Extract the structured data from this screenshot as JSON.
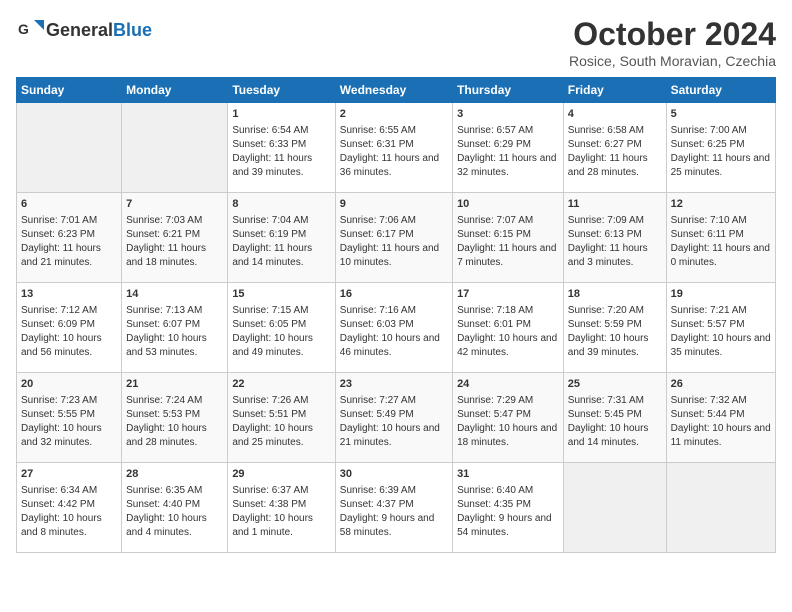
{
  "header": {
    "logo_general": "General",
    "logo_blue": "Blue",
    "month_title": "October 2024",
    "location": "Rosice, South Moravian, Czechia"
  },
  "days_of_week": [
    "Sunday",
    "Monday",
    "Tuesday",
    "Wednesday",
    "Thursday",
    "Friday",
    "Saturday"
  ],
  "weeks": [
    [
      {
        "day": "",
        "info": ""
      },
      {
        "day": "",
        "info": ""
      },
      {
        "day": "1",
        "info": "Sunrise: 6:54 AM\nSunset: 6:33 PM\nDaylight: 11 hours and 39 minutes."
      },
      {
        "day": "2",
        "info": "Sunrise: 6:55 AM\nSunset: 6:31 PM\nDaylight: 11 hours and 36 minutes."
      },
      {
        "day": "3",
        "info": "Sunrise: 6:57 AM\nSunset: 6:29 PM\nDaylight: 11 hours and 32 minutes."
      },
      {
        "day": "4",
        "info": "Sunrise: 6:58 AM\nSunset: 6:27 PM\nDaylight: 11 hours and 28 minutes."
      },
      {
        "day": "5",
        "info": "Sunrise: 7:00 AM\nSunset: 6:25 PM\nDaylight: 11 hours and 25 minutes."
      }
    ],
    [
      {
        "day": "6",
        "info": "Sunrise: 7:01 AM\nSunset: 6:23 PM\nDaylight: 11 hours and 21 minutes."
      },
      {
        "day": "7",
        "info": "Sunrise: 7:03 AM\nSunset: 6:21 PM\nDaylight: 11 hours and 18 minutes."
      },
      {
        "day": "8",
        "info": "Sunrise: 7:04 AM\nSunset: 6:19 PM\nDaylight: 11 hours and 14 minutes."
      },
      {
        "day": "9",
        "info": "Sunrise: 7:06 AM\nSunset: 6:17 PM\nDaylight: 11 hours and 10 minutes."
      },
      {
        "day": "10",
        "info": "Sunrise: 7:07 AM\nSunset: 6:15 PM\nDaylight: 11 hours and 7 minutes."
      },
      {
        "day": "11",
        "info": "Sunrise: 7:09 AM\nSunset: 6:13 PM\nDaylight: 11 hours and 3 minutes."
      },
      {
        "day": "12",
        "info": "Sunrise: 7:10 AM\nSunset: 6:11 PM\nDaylight: 11 hours and 0 minutes."
      }
    ],
    [
      {
        "day": "13",
        "info": "Sunrise: 7:12 AM\nSunset: 6:09 PM\nDaylight: 10 hours and 56 minutes."
      },
      {
        "day": "14",
        "info": "Sunrise: 7:13 AM\nSunset: 6:07 PM\nDaylight: 10 hours and 53 minutes."
      },
      {
        "day": "15",
        "info": "Sunrise: 7:15 AM\nSunset: 6:05 PM\nDaylight: 10 hours and 49 minutes."
      },
      {
        "day": "16",
        "info": "Sunrise: 7:16 AM\nSunset: 6:03 PM\nDaylight: 10 hours and 46 minutes."
      },
      {
        "day": "17",
        "info": "Sunrise: 7:18 AM\nSunset: 6:01 PM\nDaylight: 10 hours and 42 minutes."
      },
      {
        "day": "18",
        "info": "Sunrise: 7:20 AM\nSunset: 5:59 PM\nDaylight: 10 hours and 39 minutes."
      },
      {
        "day": "19",
        "info": "Sunrise: 7:21 AM\nSunset: 5:57 PM\nDaylight: 10 hours and 35 minutes."
      }
    ],
    [
      {
        "day": "20",
        "info": "Sunrise: 7:23 AM\nSunset: 5:55 PM\nDaylight: 10 hours and 32 minutes."
      },
      {
        "day": "21",
        "info": "Sunrise: 7:24 AM\nSunset: 5:53 PM\nDaylight: 10 hours and 28 minutes."
      },
      {
        "day": "22",
        "info": "Sunrise: 7:26 AM\nSunset: 5:51 PM\nDaylight: 10 hours and 25 minutes."
      },
      {
        "day": "23",
        "info": "Sunrise: 7:27 AM\nSunset: 5:49 PM\nDaylight: 10 hours and 21 minutes."
      },
      {
        "day": "24",
        "info": "Sunrise: 7:29 AM\nSunset: 5:47 PM\nDaylight: 10 hours and 18 minutes."
      },
      {
        "day": "25",
        "info": "Sunrise: 7:31 AM\nSunset: 5:45 PM\nDaylight: 10 hours and 14 minutes."
      },
      {
        "day": "26",
        "info": "Sunrise: 7:32 AM\nSunset: 5:44 PM\nDaylight: 10 hours and 11 minutes."
      }
    ],
    [
      {
        "day": "27",
        "info": "Sunrise: 6:34 AM\nSunset: 4:42 PM\nDaylight: 10 hours and 8 minutes."
      },
      {
        "day": "28",
        "info": "Sunrise: 6:35 AM\nSunset: 4:40 PM\nDaylight: 10 hours and 4 minutes."
      },
      {
        "day": "29",
        "info": "Sunrise: 6:37 AM\nSunset: 4:38 PM\nDaylight: 10 hours and 1 minute."
      },
      {
        "day": "30",
        "info": "Sunrise: 6:39 AM\nSunset: 4:37 PM\nDaylight: 9 hours and 58 minutes."
      },
      {
        "day": "31",
        "info": "Sunrise: 6:40 AM\nSunset: 4:35 PM\nDaylight: 9 hours and 54 minutes."
      },
      {
        "day": "",
        "info": ""
      },
      {
        "day": "",
        "info": ""
      }
    ]
  ]
}
